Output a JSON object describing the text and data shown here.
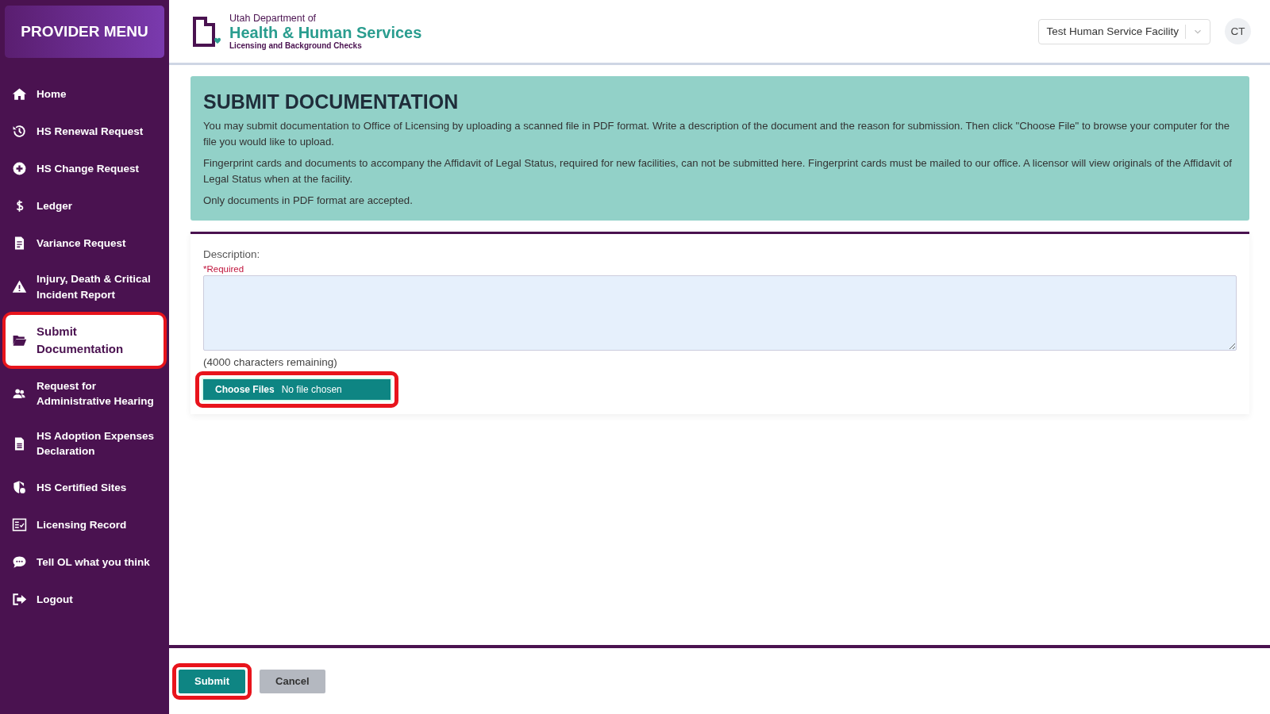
{
  "sidebar": {
    "title": "PROVIDER MENU",
    "items": [
      {
        "label": "Home",
        "selected": false,
        "highlighted": false
      },
      {
        "label": "HS Renewal Request",
        "selected": false,
        "highlighted": false
      },
      {
        "label": "HS Change Request",
        "selected": false,
        "highlighted": false
      },
      {
        "label": "Ledger",
        "selected": false,
        "highlighted": false
      },
      {
        "label": "Variance Request",
        "selected": false,
        "highlighted": false
      },
      {
        "label": "Injury, Death & Critical Incident Report",
        "selected": false,
        "highlighted": false
      },
      {
        "label": "Submit Documentation",
        "selected": true,
        "highlighted": true
      },
      {
        "label": "Request for Administrative Hearing",
        "selected": false,
        "highlighted": false
      },
      {
        "label": "HS Adoption Expenses Declaration",
        "selected": false,
        "highlighted": false
      },
      {
        "label": "HS Certified Sites",
        "selected": false,
        "highlighted": false
      },
      {
        "label": "Licensing Record",
        "selected": false,
        "highlighted": false
      },
      {
        "label": "Tell OL what you think",
        "selected": false,
        "highlighted": false
      },
      {
        "label": "Logout",
        "selected": false,
        "highlighted": false
      }
    ]
  },
  "header": {
    "logo": {
      "line1": "Utah Department of",
      "line2": "Health & Human Services",
      "line3": "Licensing and Background Checks"
    },
    "facility_select": {
      "value": "Test Human Service Facility"
    },
    "avatar": "CT"
  },
  "banner": {
    "title": "SUBMIT DOCUMENTATION",
    "paragraphs": [
      "You may submit documentation to Office of Licensing by uploading a scanned file in PDF format. Write a description of the document and the reason for submission. Then click \"Choose File\" to browse your computer for the file you would like to upload.",
      "Fingerprint cards and documents to accompany the Affidavit of Legal Status, required for new facilities, can not be submitted here. Fingerprint cards must be mailed to our office. A licensor will view originals of the Affidavit of Legal Status when at the facility.",
      "Only documents in PDF format are accepted."
    ]
  },
  "form": {
    "label": "Description:",
    "required": "*Required",
    "remaining": "(4000 characters remaining)",
    "file_input": {
      "button": "Choose Files",
      "status": "No file chosen",
      "highlighted": true
    }
  },
  "footer": {
    "buttons": [
      {
        "label": "Submit",
        "kind": "primary",
        "highlighted": true
      },
      {
        "label": "Cancel",
        "kind": "secondary",
        "highlighted": false
      }
    ]
  }
}
